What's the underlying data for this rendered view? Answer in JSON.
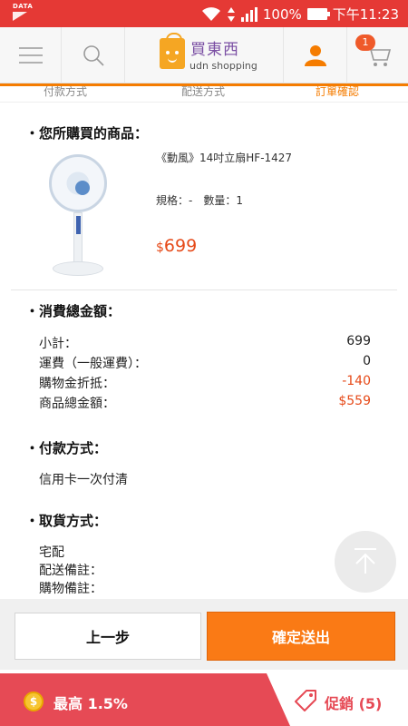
{
  "statusbar": {
    "carrier_tag": "DATA",
    "battery": "100%",
    "time": "下午11:23"
  },
  "header": {
    "logo_name": "買東西",
    "logo_sub": "udn shopping",
    "cart_count": "1"
  },
  "steps": [
    "付款方式",
    "配送方式",
    "訂單確認"
  ],
  "product_section": {
    "title": "您所購買的商品：",
    "name": "《動風》14吋立扇HF-1427",
    "spec": "規格：-　數量：1",
    "price_currency": "$",
    "price": "699"
  },
  "total_section": {
    "title": "消費總金額：",
    "rows": [
      {
        "label": "小計：",
        "value": "699"
      },
      {
        "label": "運費（一般運費）：",
        "value": "0"
      },
      {
        "label": "購物金折抵：",
        "value": "-140"
      },
      {
        "label": "商品總金額：",
        "value": "$559"
      }
    ]
  },
  "payment_section": {
    "title": "付款方式：",
    "method": "信用卡一次付清"
  },
  "pickup_section": {
    "title": "取貨方式：",
    "lines": [
      "宅配",
      "配送備註：",
      "購物備註："
    ]
  },
  "buttons": {
    "prev": "上一步",
    "next": "確定送出"
  },
  "promo": {
    "coin_symbol": "$",
    "left_text": "最高 1.5%",
    "right_text": "促銷 (5)"
  },
  "colors": {
    "status_red": "#e53935",
    "accent_orange": "#fa7a15",
    "price_red": "#e64a19",
    "promo_red": "#e64a55"
  }
}
